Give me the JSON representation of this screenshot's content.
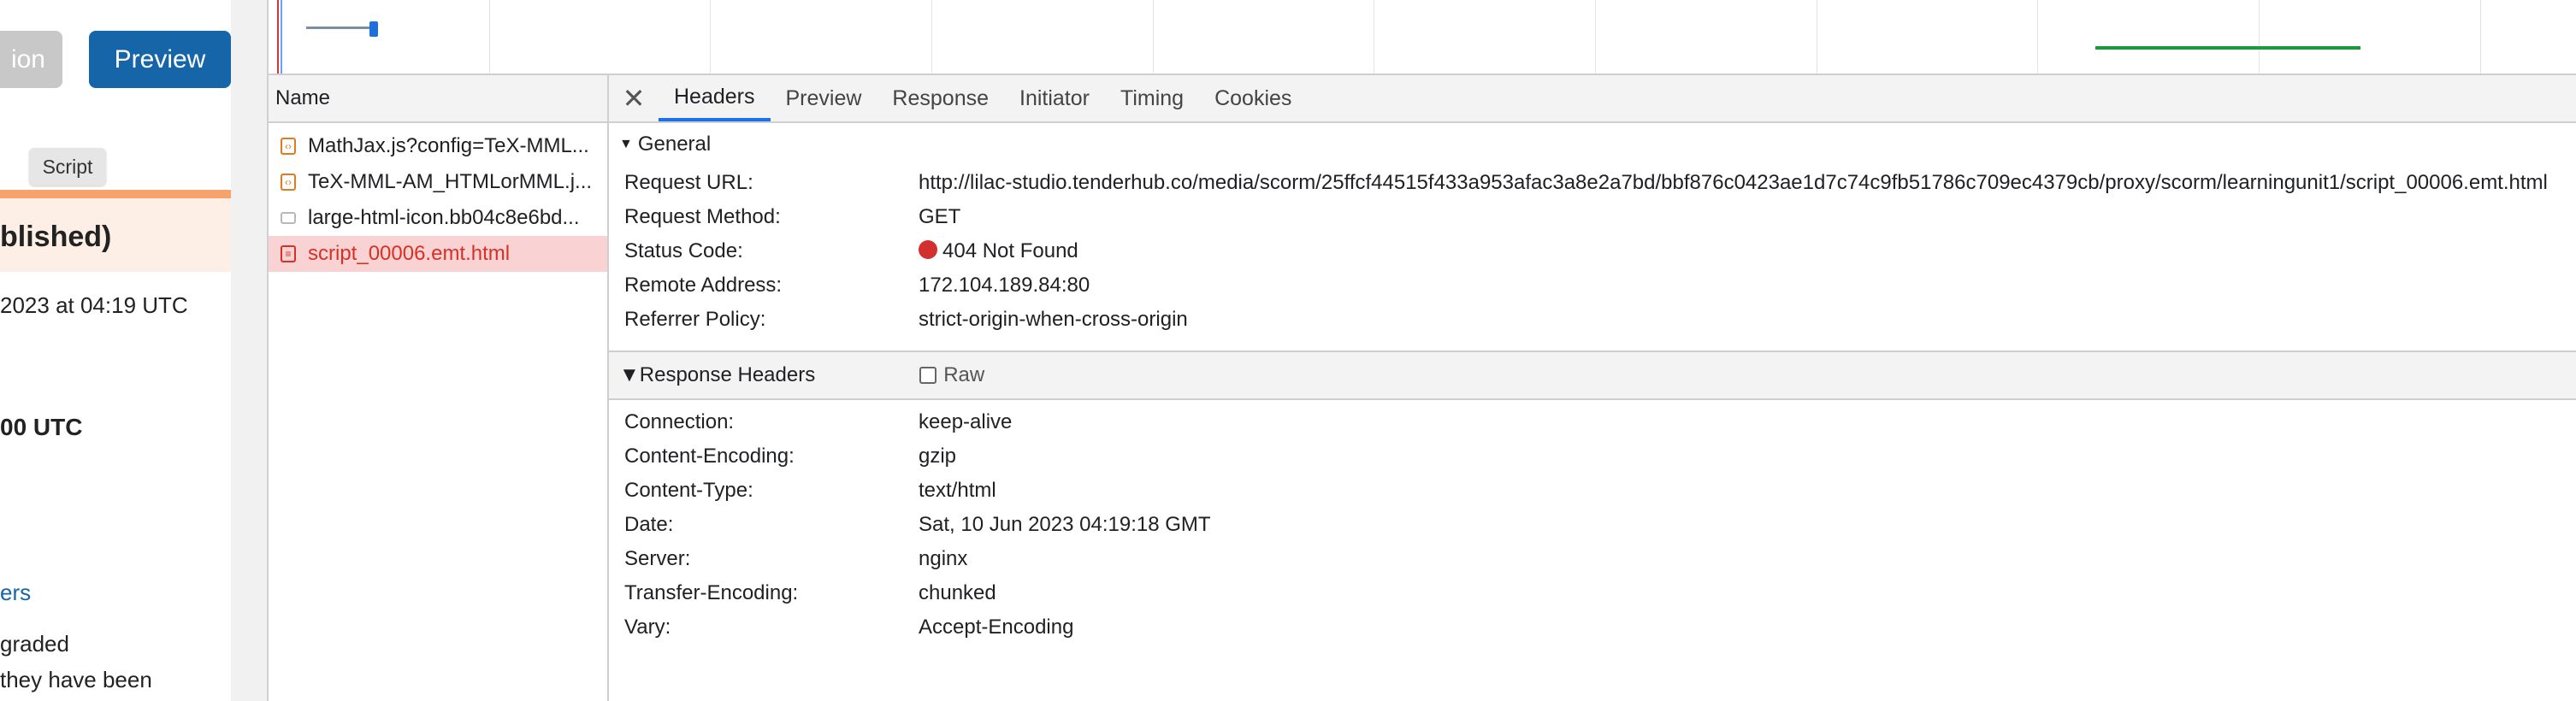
{
  "app": {
    "ghost_button_label": "ion",
    "preview_button_label": "Preview",
    "tooltip": "Script",
    "banner_text": "blished)",
    "line1": "2023 at 04:19 UTC",
    "line2": "00 UTC",
    "link": "ers",
    "line3": "graded",
    "line4": "they have been",
    "colors": {
      "preview_bg": "#1565a8",
      "banner_accent": "#f5a36b"
    }
  },
  "network": {
    "name_header": "Name",
    "requests": [
      {
        "name": "MathJax.js?config=TeX-MML...",
        "icon": "script-icon"
      },
      {
        "name": "TeX-MML-AM_HTMLorMML.j...",
        "icon": "script-icon"
      },
      {
        "name": "large-html-icon.bb04c8e6bd...",
        "icon": "image-icon"
      },
      {
        "name": "script_00006.emt.html",
        "icon": "document-icon"
      }
    ],
    "tabs": [
      "Headers",
      "Preview",
      "Response",
      "Initiator",
      "Timing",
      "Cookies"
    ],
    "close_symbol": "✕",
    "general": {
      "title": "General",
      "request_url_key": "Request URL:",
      "request_url": "http://lilac-studio.tenderhub.co/media/scorm/25ffcf44515f433a953afac3a8e2a7bd/bbf876c0423ae1d7c74c9fb51786c709ec4379cb/proxy/scorm/learningunit1/script_00006.emt.html",
      "method_key": "Request Method:",
      "method": "GET",
      "status_key": "Status Code:",
      "status": "404 Not Found",
      "remote_key": "Remote Address:",
      "remote": "172.104.189.84:80",
      "referrer_key": "Referrer Policy:",
      "referrer": "strict-origin-when-cross-origin"
    },
    "response_headers": {
      "title": "Response Headers",
      "raw_label": "Raw",
      "items": [
        {
          "k": "Connection:",
          "v": "keep-alive"
        },
        {
          "k": "Content-Encoding:",
          "v": "gzip"
        },
        {
          "k": "Content-Type:",
          "v": "text/html"
        },
        {
          "k": "Date:",
          "v": "Sat, 10 Jun 2023 04:19:18 GMT"
        },
        {
          "k": "Server:",
          "v": "nginx"
        },
        {
          "k": "Transfer-Encoding:",
          "v": "chunked"
        },
        {
          "k": "Vary:",
          "v": "Accept-Encoding"
        }
      ]
    },
    "colors": {
      "status_error": "#d32f2f",
      "selected_row_bg": "#f9d3d3",
      "active_tab": "#1a73e8"
    }
  }
}
